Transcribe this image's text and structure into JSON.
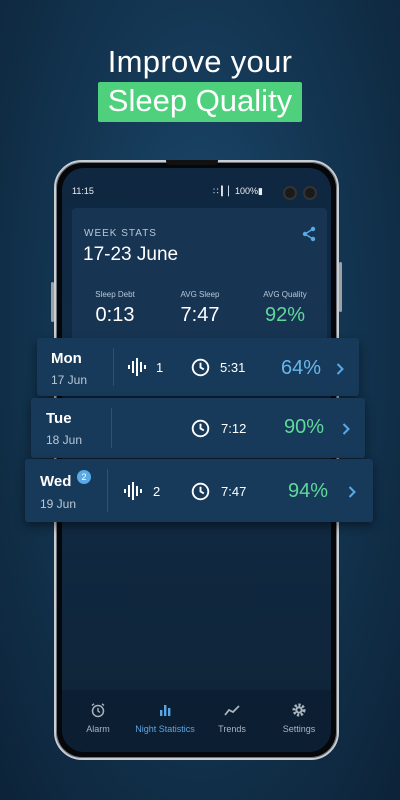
{
  "promo": {
    "headline": "Improve your",
    "highlight": "Sleep Quality"
  },
  "colors": {
    "accent_green": "#4fd07c",
    "quality_blue": "#65b7ee",
    "quality_green": "#5fd99a",
    "nav_active": "#5aa6e4"
  },
  "status_bar": {
    "time": "11:15",
    "indicators": "∷ ▎▏100%▮"
  },
  "week_stats": {
    "label": "WEEK STATS",
    "range": "17-23 June",
    "share_icon": "share-icon",
    "stats": [
      {
        "label": "Sleep Debt",
        "value": "0:13"
      },
      {
        "label": "AVG Sleep",
        "value": "7:47"
      },
      {
        "label": "AVG Quality",
        "value": "92%"
      }
    ]
  },
  "days": [
    {
      "name": "Mon",
      "date": "17 Jun",
      "events": "1",
      "duration": "5:31",
      "quality": "64%"
    },
    {
      "name": "Tue",
      "date": "18 Jun",
      "duration": "7:12",
      "quality": "90%"
    },
    {
      "name": "Wed",
      "date": "19 Jun",
      "badge": "2",
      "events": "2",
      "duration": "7:47",
      "quality": "94%"
    }
  ],
  "nav": [
    {
      "label": "Alarm",
      "icon": "alarm-clock-icon"
    },
    {
      "label": "Night Statistics",
      "icon": "bar-chart-icon"
    },
    {
      "label": "Trends",
      "icon": "trend-line-icon"
    },
    {
      "label": "Settings",
      "icon": "gear-icon"
    }
  ]
}
